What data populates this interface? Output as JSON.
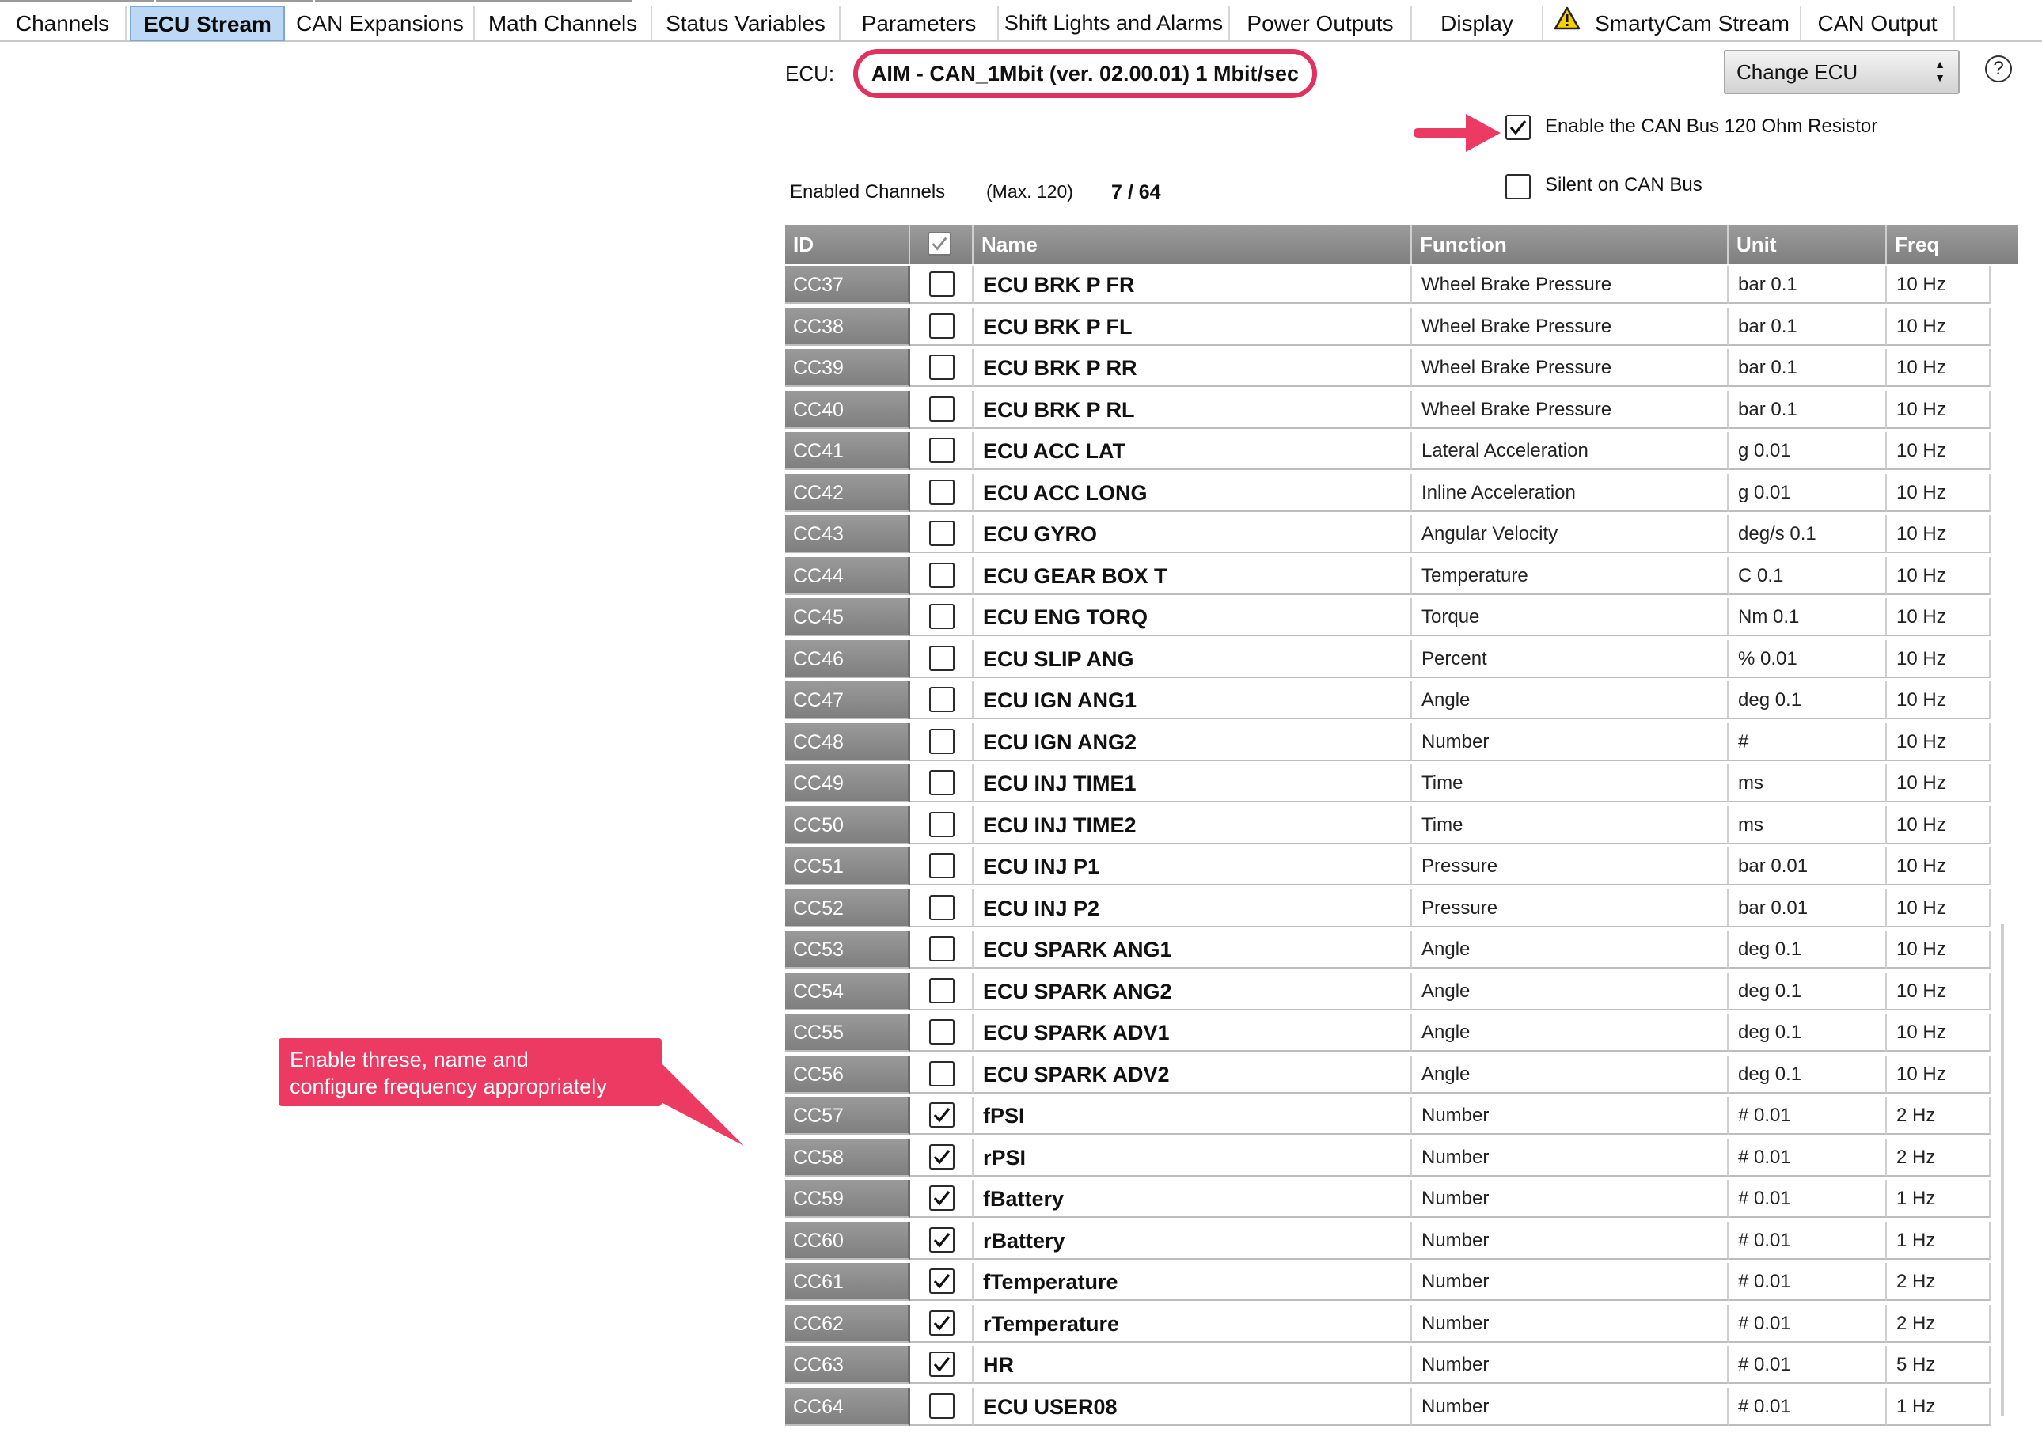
{
  "tabs": [
    {
      "label": "Channels",
      "active": false
    },
    {
      "label": "ECU Stream",
      "active": true
    },
    {
      "label": "CAN Expansions",
      "active": false
    },
    {
      "label": "Math Channels",
      "active": false
    },
    {
      "label": "Status Variables",
      "active": false
    },
    {
      "label": "Parameters",
      "active": false
    },
    {
      "label": "Shift Lights and Alarms",
      "active": false
    },
    {
      "label": "Power Outputs",
      "active": false
    },
    {
      "label": "Display",
      "active": false
    },
    {
      "label": "SmartyCam Stream",
      "active": false,
      "icon": "warning-icon"
    },
    {
      "label": "CAN Output",
      "active": false
    }
  ],
  "ecu": {
    "label": "ECU:",
    "value": "AIM - CAN_1Mbit (ver. 02.00.01) 1 Mbit/sec",
    "change_button": "Change ECU",
    "help": "?"
  },
  "options": {
    "resistor": {
      "label": "Enable the CAN Bus 120 Ohm Resistor",
      "checked": true
    },
    "silent": {
      "label": "Silent on CAN Bus",
      "checked": false
    }
  },
  "enabled": {
    "label": "Enabled Channels",
    "max": "(Max. 120)",
    "count": "7 / 64"
  },
  "table": {
    "columns": [
      "ID",
      "",
      "Name",
      "Function",
      "Unit",
      "Freq"
    ],
    "rows": [
      {
        "id": "CC37",
        "checked": false,
        "name": "ECU BRK P FR",
        "function": "Wheel Brake Pressure",
        "unit": "bar 0.1",
        "freq": "10 Hz"
      },
      {
        "id": "CC38",
        "checked": false,
        "name": "ECU BRK P FL",
        "function": "Wheel Brake Pressure",
        "unit": "bar 0.1",
        "freq": "10 Hz"
      },
      {
        "id": "CC39",
        "checked": false,
        "name": "ECU BRK P RR",
        "function": "Wheel Brake Pressure",
        "unit": "bar 0.1",
        "freq": "10 Hz"
      },
      {
        "id": "CC40",
        "checked": false,
        "name": "ECU BRK P RL",
        "function": "Wheel Brake Pressure",
        "unit": "bar 0.1",
        "freq": "10 Hz"
      },
      {
        "id": "CC41",
        "checked": false,
        "name": "ECU ACC LAT",
        "function": "Lateral Acceleration",
        "unit": "g 0.01",
        "freq": "10 Hz"
      },
      {
        "id": "CC42",
        "checked": false,
        "name": "ECU ACC LONG",
        "function": "Inline Acceleration",
        "unit": "g 0.01",
        "freq": "10 Hz"
      },
      {
        "id": "CC43",
        "checked": false,
        "name": "ECU GYRO",
        "function": "Angular Velocity",
        "unit": "deg/s 0.1",
        "freq": "10 Hz"
      },
      {
        "id": "CC44",
        "checked": false,
        "name": "ECU GEAR BOX T",
        "function": "Temperature",
        "unit": "C 0.1",
        "freq": "10 Hz"
      },
      {
        "id": "CC45",
        "checked": false,
        "name": "ECU ENG TORQ",
        "function": "Torque",
        "unit": "Nm 0.1",
        "freq": "10 Hz"
      },
      {
        "id": "CC46",
        "checked": false,
        "name": "ECU SLIP ANG",
        "function": "Percent",
        "unit": "% 0.01",
        "freq": "10 Hz"
      },
      {
        "id": "CC47",
        "checked": false,
        "name": "ECU IGN ANG1",
        "function": "Angle",
        "unit": "deg 0.1",
        "freq": "10 Hz"
      },
      {
        "id": "CC48",
        "checked": false,
        "name": "ECU IGN ANG2",
        "function": "Number",
        "unit": "#",
        "freq": "10 Hz"
      },
      {
        "id": "CC49",
        "checked": false,
        "name": "ECU INJ TIME1",
        "function": "Time",
        "unit": "ms",
        "freq": "10 Hz"
      },
      {
        "id": "CC50",
        "checked": false,
        "name": "ECU INJ TIME2",
        "function": "Time",
        "unit": "ms",
        "freq": "10 Hz"
      },
      {
        "id": "CC51",
        "checked": false,
        "name": "ECU INJ P1",
        "function": "Pressure",
        "unit": "bar 0.01",
        "freq": "10 Hz"
      },
      {
        "id": "CC52",
        "checked": false,
        "name": "ECU INJ P2",
        "function": "Pressure",
        "unit": "bar 0.01",
        "freq": "10 Hz"
      },
      {
        "id": "CC53",
        "checked": false,
        "name": "ECU SPARK ANG1",
        "function": "Angle",
        "unit": "deg 0.1",
        "freq": "10 Hz"
      },
      {
        "id": "CC54",
        "checked": false,
        "name": "ECU SPARK ANG2",
        "function": "Angle",
        "unit": "deg 0.1",
        "freq": "10 Hz"
      },
      {
        "id": "CC55",
        "checked": false,
        "name": "ECU SPARK ADV1",
        "function": "Angle",
        "unit": "deg 0.1",
        "freq": "10 Hz"
      },
      {
        "id": "CC56",
        "checked": false,
        "name": "ECU SPARK ADV2",
        "function": "Angle",
        "unit": "deg 0.1",
        "freq": "10 Hz"
      },
      {
        "id": "CC57",
        "checked": true,
        "name": "fPSI",
        "function": "Number",
        "unit": "# 0.01",
        "freq": "2 Hz"
      },
      {
        "id": "CC58",
        "checked": true,
        "name": "rPSI",
        "function": "Number",
        "unit": "# 0.01",
        "freq": "2 Hz"
      },
      {
        "id": "CC59",
        "checked": true,
        "name": "fBattery",
        "function": "Number",
        "unit": "# 0.01",
        "freq": "1 Hz"
      },
      {
        "id": "CC60",
        "checked": true,
        "name": "rBattery",
        "function": "Number",
        "unit": "# 0.01",
        "freq": "1 Hz"
      },
      {
        "id": "CC61",
        "checked": true,
        "name": "fTemperature",
        "function": "Number",
        "unit": "# 0.01",
        "freq": "2 Hz"
      },
      {
        "id": "CC62",
        "checked": true,
        "name": "rTemperature",
        "function": "Number",
        "unit": "# 0.01",
        "freq": "2 Hz"
      },
      {
        "id": "CC63",
        "checked": true,
        "name": "HR",
        "function": "Number",
        "unit": "# 0.01",
        "freq": "5 Hz"
      },
      {
        "id": "CC64",
        "checked": false,
        "name": "ECU USER08",
        "function": "Number",
        "unit": "# 0.01",
        "freq": "1 Hz"
      }
    ]
  },
  "annotation": {
    "callout_line1": "Enable threse, name and",
    "callout_line2": "configure frequency appropriately"
  },
  "colors": {
    "annotation": "#ec3a62",
    "active_tab": "#bcd8f5",
    "header_gray": "#8c8c8c"
  }
}
